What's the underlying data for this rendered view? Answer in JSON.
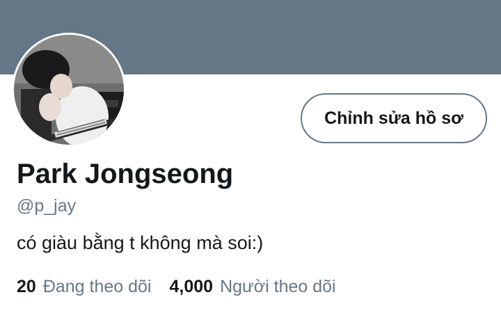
{
  "colors": {
    "banner": "#657786",
    "text_primary": "#14171a",
    "text_secondary": "#657786",
    "button_border": "#657786"
  },
  "profile": {
    "avatar_icon": "profile-photo",
    "name": "Park Jongseong",
    "handle": "@p_jay",
    "bio": "có giàu bằng t không mà soi:)",
    "edit_button_label": "Chỉnh sửa hồ sơ"
  },
  "stats": [
    {
      "count": "20",
      "label": "Đang theo dõi"
    },
    {
      "count": "4,000",
      "label": "Người theo dõi"
    }
  ]
}
